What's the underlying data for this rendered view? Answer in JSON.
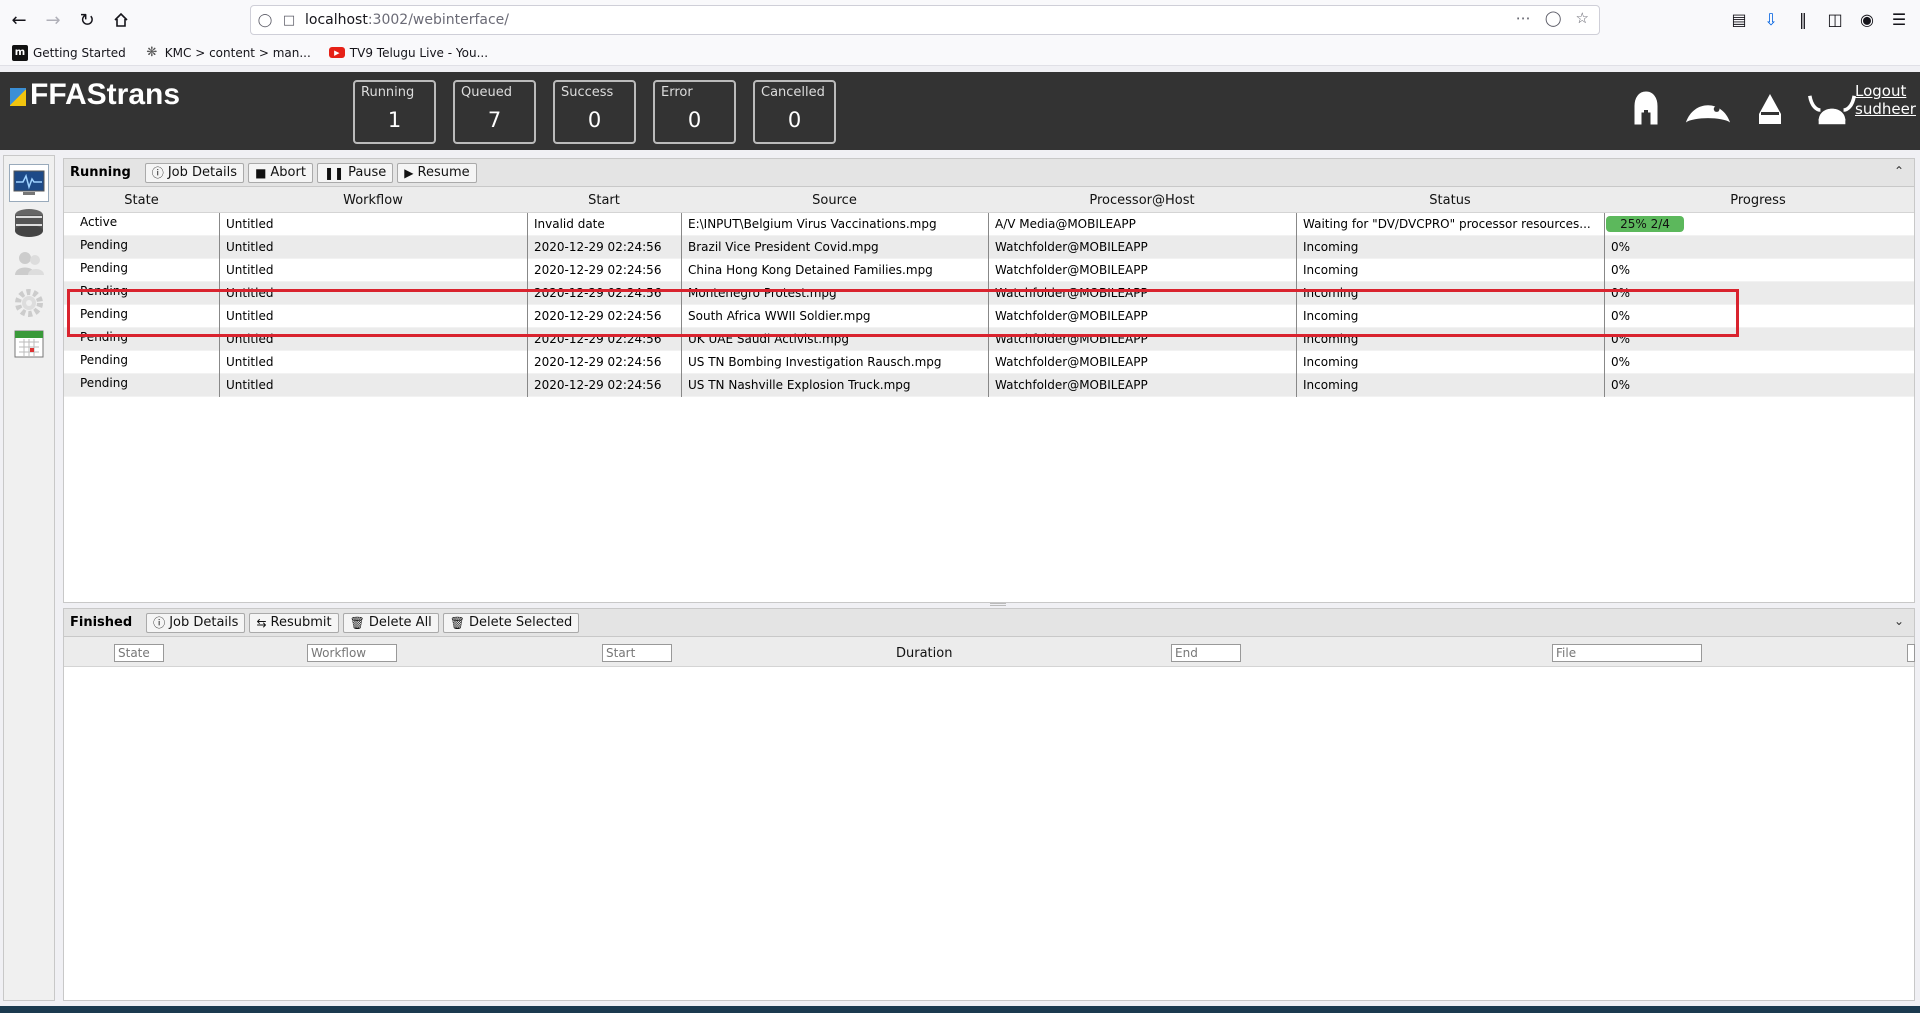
{
  "browser": {
    "url_host": "localhost",
    "url_path": ":3002/webinterface/",
    "bookmarks": [
      {
        "icon": "m",
        "label": "Getting Started"
      },
      {
        "icon": "kmc",
        "label": "KMC > content > man..."
      },
      {
        "icon": "youtube",
        "label": "TV9 Telugu Live - You..."
      }
    ]
  },
  "app": {
    "title": "FFAStrans",
    "logout_label": "Logout",
    "username": "sudheer"
  },
  "counters": [
    {
      "label": "Running",
      "value": "1"
    },
    {
      "label": "Queued",
      "value": "7"
    },
    {
      "label": "Success",
      "value": "0"
    },
    {
      "label": "Error",
      "value": "0"
    },
    {
      "label": "Cancelled",
      "value": "0"
    }
  ],
  "running": {
    "title": "Running",
    "buttons": {
      "job_details": "Job Details",
      "abort": "Abort",
      "pause": "Pause",
      "resume": "Resume"
    },
    "columns": [
      "State",
      "Workflow",
      "Start",
      "Source",
      "Processor@Host",
      "Status",
      "Progress"
    ],
    "rows": [
      {
        "state": "Active",
        "workflow": "Untitled",
        "start": "Invalid date",
        "source": "E:\\INPUT\\Belgium Virus Vaccinations.mpg",
        "processor": "A/V Media@MOBILEAPP",
        "status": "Waiting for \"DV/DVCPRO\" processor resources...",
        "progress": "25% 2/4",
        "progress_fraction": 0.25
      },
      {
        "state": "Pending",
        "workflow": "Untitled",
        "start": "2020-12-29 02:24:56",
        "source": "Brazil Vice President Covid.mpg",
        "processor": "Watchfolder@MOBILEAPP",
        "status": "Incoming",
        "progress": "0%"
      },
      {
        "state": "Pending",
        "workflow": "Untitled",
        "start": "2020-12-29 02:24:56",
        "source": "China Hong Kong Detained Families.mpg",
        "processor": "Watchfolder@MOBILEAPP",
        "status": "Incoming",
        "progress": "0%"
      },
      {
        "state": "Pending",
        "workflow": "Untitled",
        "start": "2020-12-29 02:24:56",
        "source": "Montenegro Protest.mpg",
        "processor": "Watchfolder@MOBILEAPP",
        "status": "Incoming",
        "progress": "0%"
      },
      {
        "state": "Pending",
        "workflow": "Untitled",
        "start": "2020-12-29 02:24:56",
        "source": "South Africa WWII Soldier.mpg",
        "processor": "Watchfolder@MOBILEAPP",
        "status": "Incoming",
        "progress": "0%"
      },
      {
        "state": "Pending",
        "workflow": "Untitled",
        "start": "2020-12-29 02:24:56",
        "source": "UK UAE Saudi Activist.mpg",
        "processor": "Watchfolder@MOBILEAPP",
        "status": "Incoming",
        "progress": "0%"
      },
      {
        "state": "Pending",
        "workflow": "Untitled",
        "start": "2020-12-29 02:24:56",
        "source": "US TN Bombing Investigation Rausch.mpg",
        "processor": "Watchfolder@MOBILEAPP",
        "status": "Incoming",
        "progress": "0%"
      },
      {
        "state": "Pending",
        "workflow": "Untitled",
        "start": "2020-12-29 02:24:56",
        "source": "US TN Nashville Explosion Truck.mpg",
        "processor": "Watchfolder@MOBILEAPP",
        "status": "Incoming",
        "progress": "0%"
      }
    ]
  },
  "finished": {
    "title": "Finished",
    "buttons": {
      "job_details": "Job Details",
      "resubmit": "Resubmit",
      "delete_all": "Delete All",
      "delete_selected": "Delete Selected"
    },
    "filters": {
      "state": "State",
      "workflow": "Workflow",
      "start": "Start",
      "duration": "Duration",
      "end": "End",
      "file": "File"
    }
  },
  "colors": {
    "header_bg": "#333333",
    "progress": "#5cb85c",
    "highlight": "#d9232e"
  }
}
